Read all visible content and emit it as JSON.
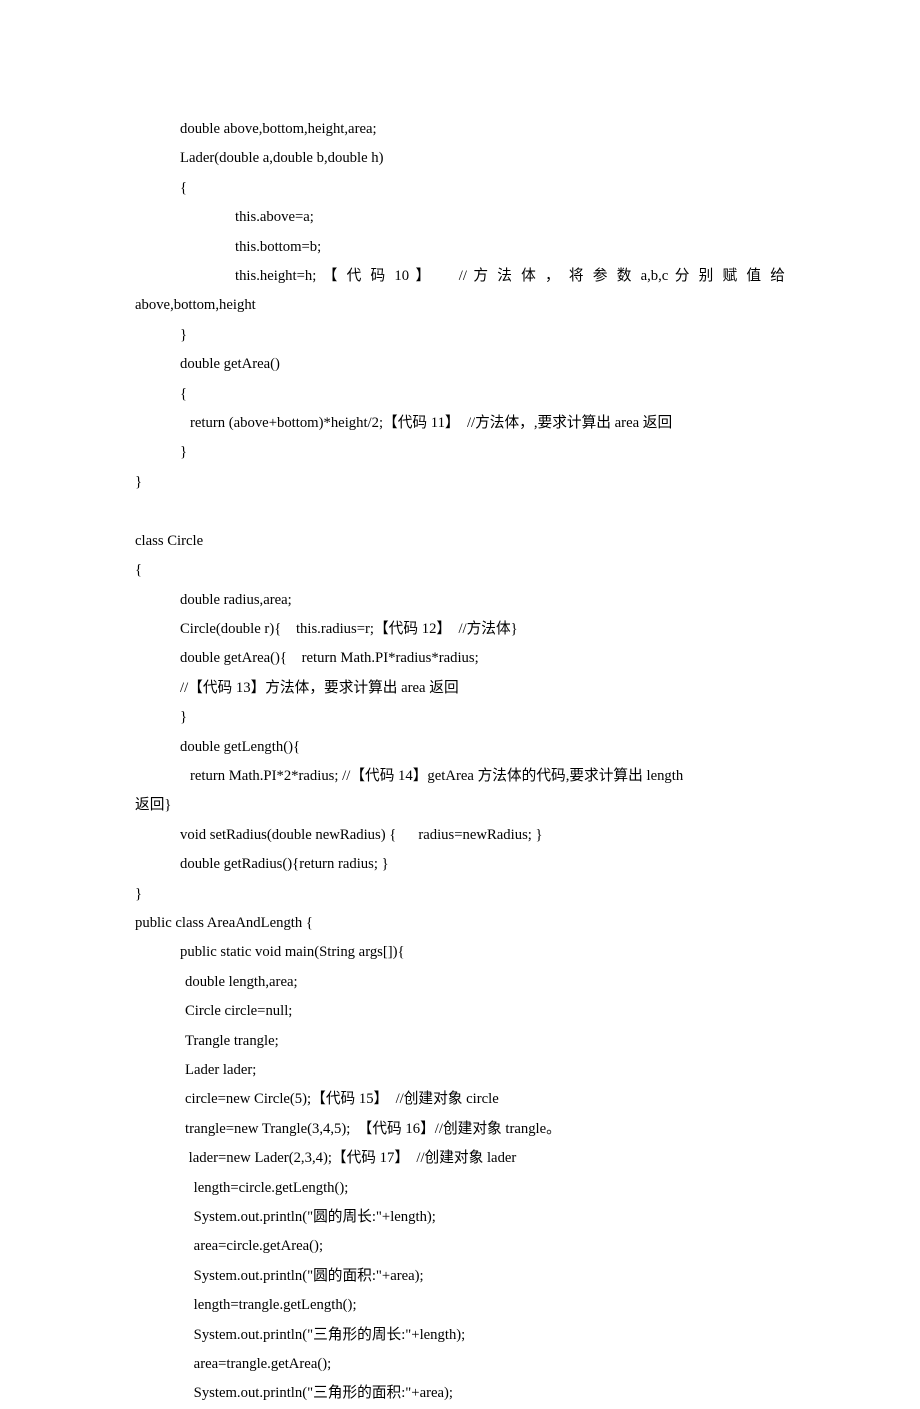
{
  "lines": [
    {
      "text": "double above,bottom,height,area;",
      "cls": "ind1"
    },
    {
      "text": "Lader(double a,double b,double h)",
      "cls": "ind1"
    },
    {
      "text": "{",
      "cls": "ind1"
    },
    {
      "text": "this.above=a;",
      "cls": "ind2"
    },
    {
      "text": "this.bottom=b;",
      "cls": "ind2"
    },
    {
      "text": "this.height=h; 【 代 码 10 】    // 方 法 体 ， 将 参 数 a,b,c 分 别 赋 值 给",
      "cls": "ind2 justify"
    },
    {
      "text": "above,bottom,height",
      "cls": ""
    },
    {
      "text": "}",
      "cls": "ind1"
    },
    {
      "text": "double getArea()",
      "cls": "ind1"
    },
    {
      "text": "{",
      "cls": "ind1"
    },
    {
      "text": "return (above+bottom)*height/2;【代码 11】  //方法体，,要求计算出 area 返回",
      "cls": "ind3"
    },
    {
      "text": "}",
      "cls": "ind1"
    },
    {
      "text": "}",
      "cls": ""
    },
    {
      "text": " ",
      "cls": ""
    },
    {
      "text": "class Circle",
      "cls": ""
    },
    {
      "text": "{",
      "cls": ""
    },
    {
      "text": "double radius,area;",
      "cls": "ind1"
    },
    {
      "text": "Circle(double r){    this.radius=r;【代码 12】  //方法体}",
      "cls": "ind1"
    },
    {
      "text": "double getArea(){    return Math.PI*radius*radius;",
      "cls": "ind1"
    },
    {
      "text": "//【代码 13】方法体，要求计算出 area 返回",
      "cls": "ind1"
    },
    {
      "text": "}",
      "cls": "ind1"
    },
    {
      "text": "double getLength(){",
      "cls": "ind1"
    },
    {
      "text": "return Math.PI*2*radius; //【代码 14】getArea 方法体的代码,要求计算出 length",
      "cls": "ind3"
    },
    {
      "text": "返回}",
      "cls": ""
    },
    {
      "text": "void setRadius(double newRadius) {      radius=newRadius; }",
      "cls": "ind1"
    },
    {
      "text": "double getRadius(){return radius; }",
      "cls": "ind1"
    },
    {
      "text": "}",
      "cls": ""
    },
    {
      "text": "public class AreaAndLength {",
      "cls": ""
    },
    {
      "text": "public static void main(String args[]){",
      "cls": "ind1"
    },
    {
      "text": "double length,area;",
      "cls": "ind4"
    },
    {
      "text": "Circle circle=null;",
      "cls": "ind4"
    },
    {
      "text": "Trangle trangle;",
      "cls": "ind4"
    },
    {
      "text": "Lader lader;",
      "cls": "ind4"
    },
    {
      "text": "circle=new Circle(5);【代码 15】  //创建对象 circle",
      "cls": "ind4"
    },
    {
      "text": "trangle=new Trangle(3,4,5);  【代码 16】//创建对象 trangle。",
      "cls": "ind4"
    },
    {
      "text": " lader=new Lader(2,3,4);【代码 17】  //创建对象 lader",
      "cls": "ind4"
    },
    {
      "text": " length=circle.getLength();",
      "cls": "ind5"
    },
    {
      "text": " System.out.println(\"圆的周长:\"+length);",
      "cls": "ind5"
    },
    {
      "text": " area=circle.getArea();",
      "cls": "ind5"
    },
    {
      "text": " System.out.println(\"圆的面积:\"+area);",
      "cls": "ind5"
    },
    {
      "text": " length=trangle.getLength();",
      "cls": "ind5"
    },
    {
      "text": " System.out.println(\"三角形的周长:\"+length);",
      "cls": "ind5"
    },
    {
      "text": " area=trangle.getArea();",
      "cls": "ind5"
    },
    {
      "text": " System.out.println(\"三角形的面积:\"+area);",
      "cls": "ind5"
    }
  ]
}
